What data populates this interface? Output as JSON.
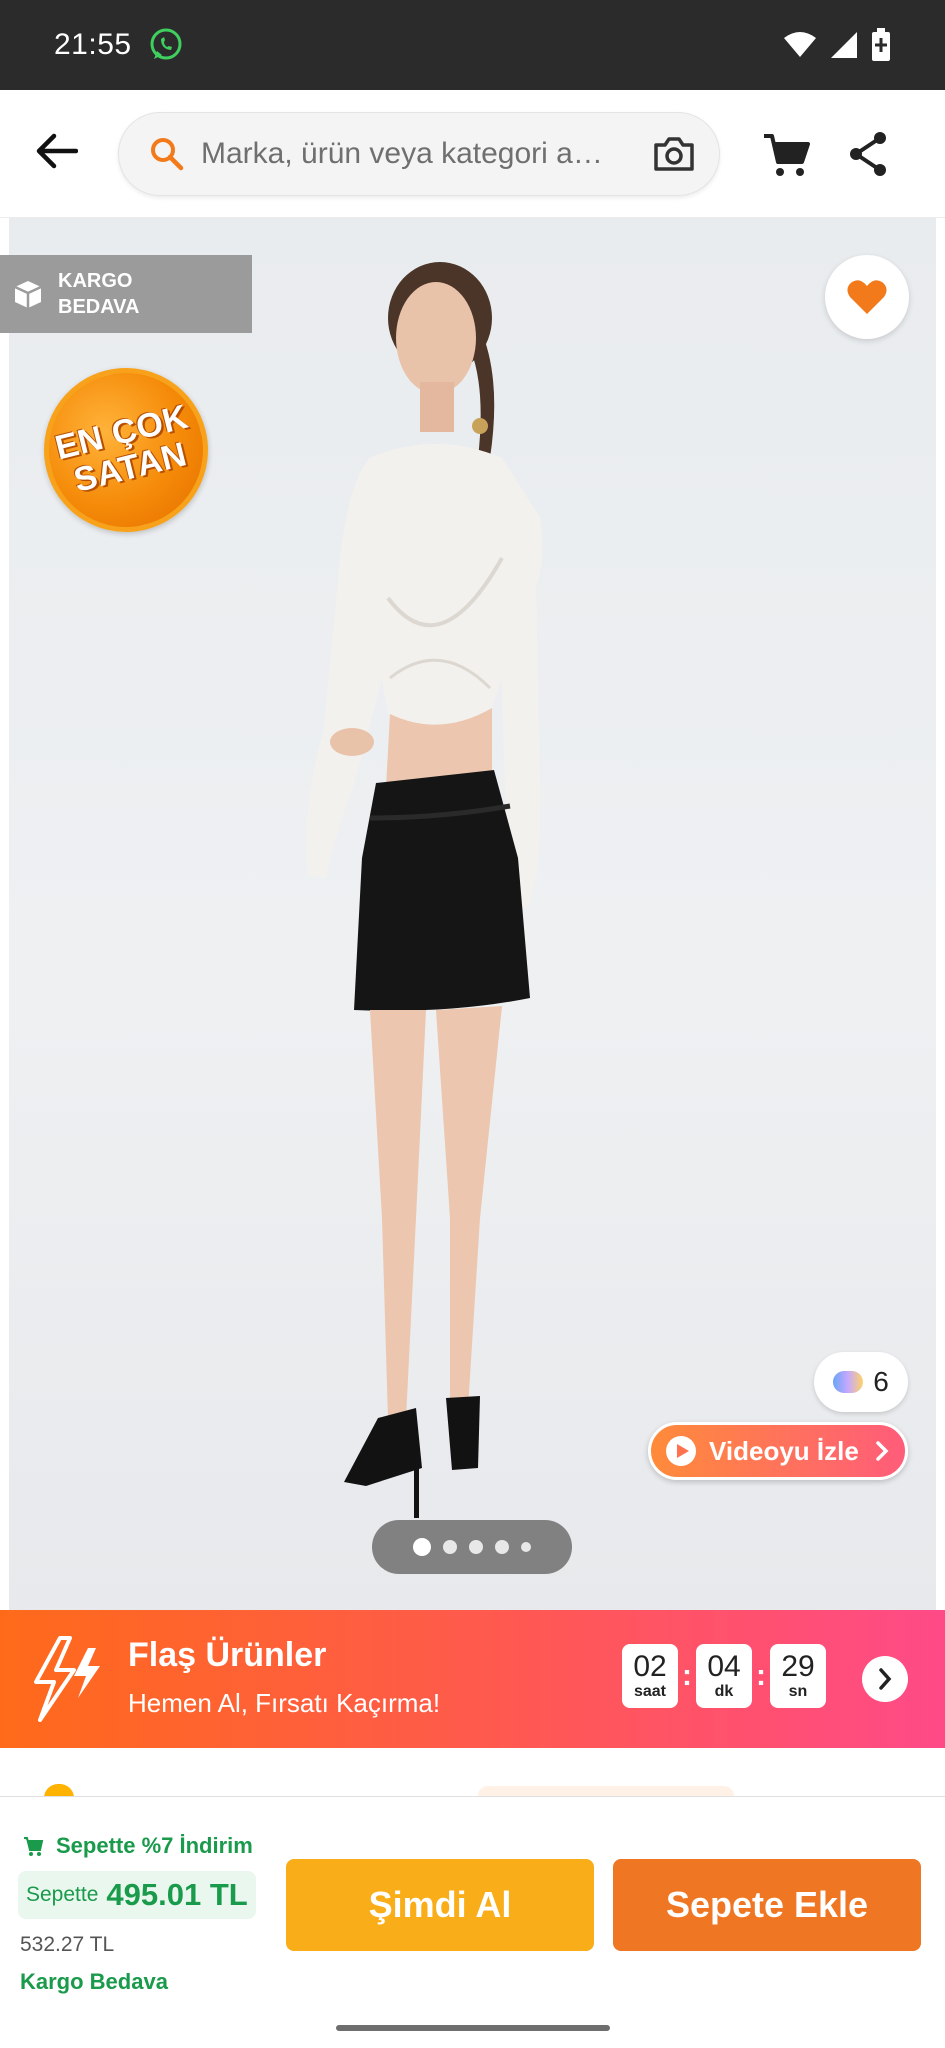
{
  "status_bar": {
    "time": "21:55",
    "icons": [
      "whatsapp-icon",
      "wifi-icon",
      "signal-icon",
      "battery-icon"
    ]
  },
  "top_bar": {
    "search_placeholder": "Marka, ürün veya kategori a…",
    "icons": [
      "back-arrow-icon",
      "search-icon",
      "camera-icon",
      "cart-icon",
      "share-icon"
    ]
  },
  "product_image": {
    "kargo_badge": [
      "KARGO",
      "BEDAVA"
    ],
    "best_seller_badge": [
      "EN ÇOK",
      "SATAN"
    ],
    "color_count": "6",
    "video_button": "Videoyu İzle",
    "carousel": {
      "total": 5,
      "active_index": 0
    }
  },
  "flash_banner": {
    "title": "Flaş Ürünler",
    "subtitle": "Hemen Al, Fırsatı Kaçırma!",
    "timer": [
      {
        "value": "02",
        "unit": "saat"
      },
      {
        "value": "04",
        "unit": "dk"
      },
      {
        "value": "29",
        "unit": "sn"
      }
    ],
    "separator": ":"
  },
  "purchase_bar": {
    "promo": "Sepette %7 İndirim",
    "price_prefix": "Sepette",
    "price": "495.01 TL",
    "old_price": "532.27 TL",
    "shipping": "Kargo Bedava",
    "buy_now": "Şimdi Al",
    "add_to_cart": "Sepete Ekle"
  },
  "colors": {
    "accent_orange": "#ef7622",
    "buy_yellow": "#f9ad18",
    "promo_green": "#1a9a4b",
    "status_bar_bg": "#2b2b2b"
  }
}
